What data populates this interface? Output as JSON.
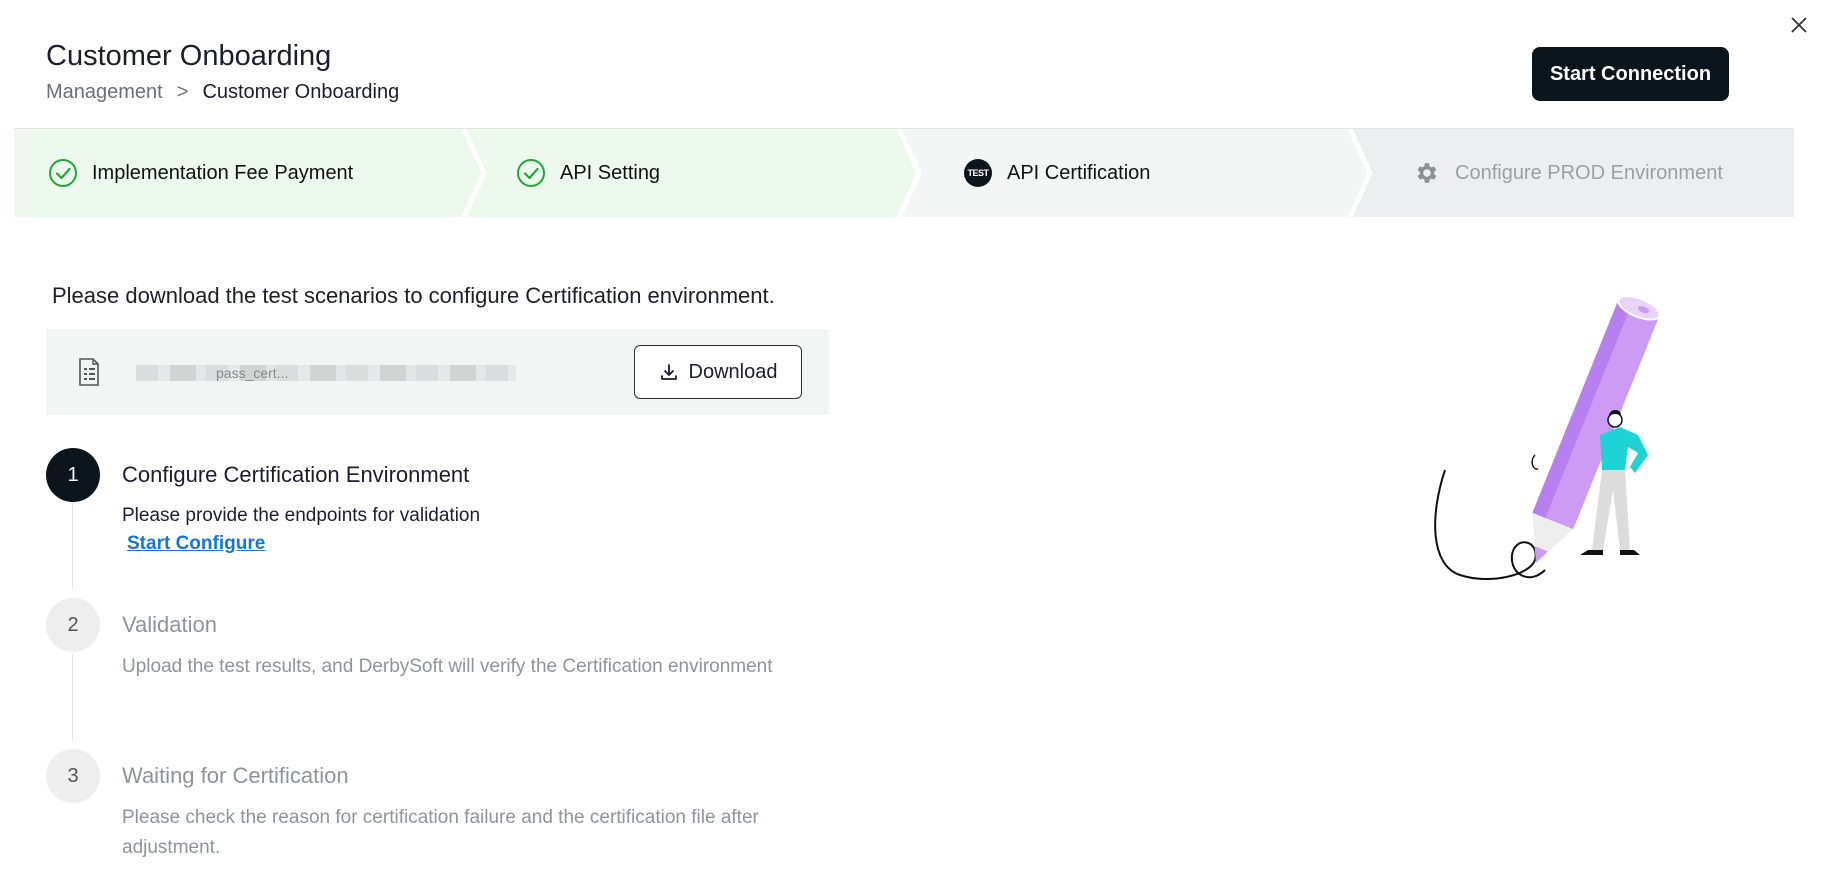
{
  "header": {
    "title": "Customer Onboarding",
    "breadcrumb": {
      "parent": "Management",
      "separator": ">",
      "current": "Customer Onboarding"
    },
    "primary_button": "Start Connection"
  },
  "steps": [
    {
      "label": "Implementation Fee Payment",
      "status": "completed",
      "icon": "check-circle-icon"
    },
    {
      "label": "API Setting",
      "status": "completed",
      "icon": "check-circle-icon"
    },
    {
      "label": "API Certification",
      "status": "current",
      "icon": "test-badge-icon",
      "badge_text": "TEST"
    },
    {
      "label": "Configure PROD Environment",
      "status": "pending",
      "icon": "gear-icon"
    }
  ],
  "main": {
    "instruction": "Please download the test scenarios to configure Certification environment.",
    "file": {
      "icon": "document-icon",
      "name": "pass_cert..."
    },
    "download_label": "Download",
    "substeps": [
      {
        "number": "1",
        "title": "Configure Certification Environment",
        "description": "Please provide the endpoints for validation",
        "link": "Start Configure",
        "state": "active"
      },
      {
        "number": "2",
        "title": "Validation",
        "description": "Upload the test results, and DerbySoft will verify the Certification environment",
        "state": "inactive"
      },
      {
        "number": "3",
        "title": "Waiting for Certification",
        "description": "Please check the reason for certification failure and the certification file after adjustment.",
        "state": "inactive"
      }
    ]
  },
  "colors": {
    "primary_dark": "#0c141c",
    "completed_bg": "#eef9ee",
    "current_bg": "#f4f6f5",
    "pending_bg": "#eceeef",
    "success_green": "#22a63a",
    "link_blue": "#1677d1",
    "pencil_purple": "#cc9cf5",
    "shirt_cyan": "#1ed3d3"
  }
}
